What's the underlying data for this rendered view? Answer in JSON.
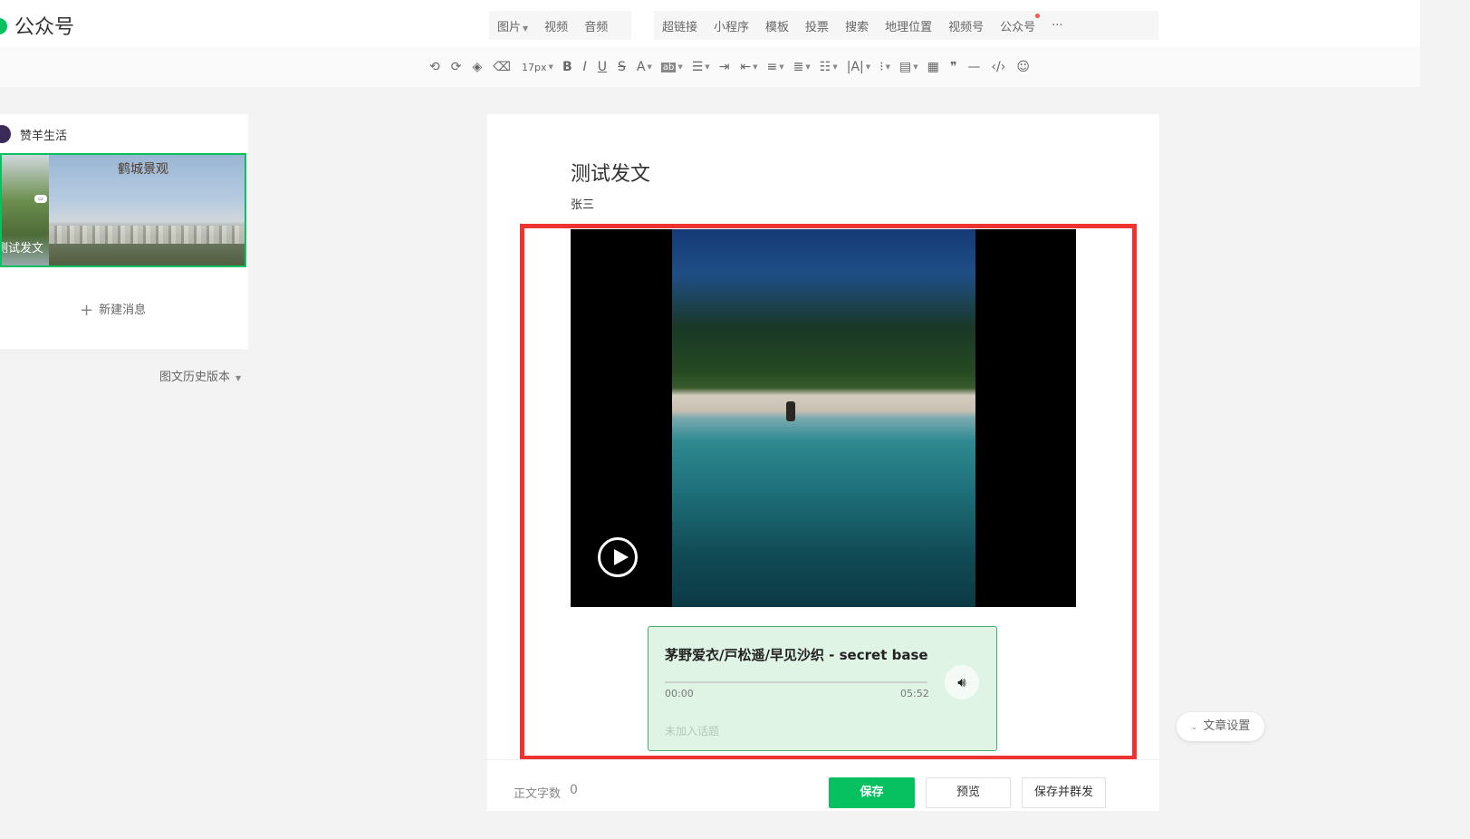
{
  "brand": {
    "name": "公众号",
    "accent": "#07c160"
  },
  "insert_menu": {
    "group1": [
      {
        "label": "图片",
        "caret": true
      },
      {
        "label": "视频"
      },
      {
        "label": "音频"
      }
    ],
    "group2": [
      {
        "label": "超链接"
      },
      {
        "label": "小程序"
      },
      {
        "label": "模板"
      },
      {
        "label": "投票"
      },
      {
        "label": "搜索"
      },
      {
        "label": "地理位置"
      },
      {
        "label": "视频号"
      },
      {
        "label": "公众号",
        "dot": true
      },
      {
        "label": "···"
      }
    ]
  },
  "toolbar": {
    "font_size": "17px",
    "icons": [
      "undo-icon",
      "redo-icon",
      "format-brush-icon",
      "clear-format-icon",
      "bold-icon",
      "italic-icon",
      "underline-icon",
      "strikethrough-icon",
      "font-color-icon",
      "highlight-icon",
      "align-icon",
      "indent-icon",
      "outdent-icon",
      "line-spacing-icon",
      "paragraph-spacing-icon",
      "list-icon",
      "letter-spacing-icon",
      "bullet-list-icon",
      "float-icon",
      "table-icon",
      "quote-icon",
      "divider-icon",
      "code-icon",
      "emoji-icon"
    ]
  },
  "sidebar": {
    "account_name": "赞羊生活",
    "thumb_title": "鹤城景观",
    "thumb_caption": "测试发文",
    "new_message": "新建消息",
    "history": "图文历史版本"
  },
  "article": {
    "title": "测试发文",
    "author": "张三"
  },
  "audio": {
    "title": "茅野爱衣/戸松遥/早见沙织 - secret base",
    "current_time": "00:00",
    "duration": "05:52",
    "topic_placeholder": "未加入话题"
  },
  "footer": {
    "word_count_label": "正文字数",
    "word_count": "0",
    "save": "保存",
    "preview": "预览",
    "save_and_send": "保存并群发"
  },
  "article_settings": "文章设置",
  "colors": {
    "highlight_border": "#ee3333",
    "audio_card_bg": "#e0f4e6",
    "primary_button": "#07c160"
  }
}
